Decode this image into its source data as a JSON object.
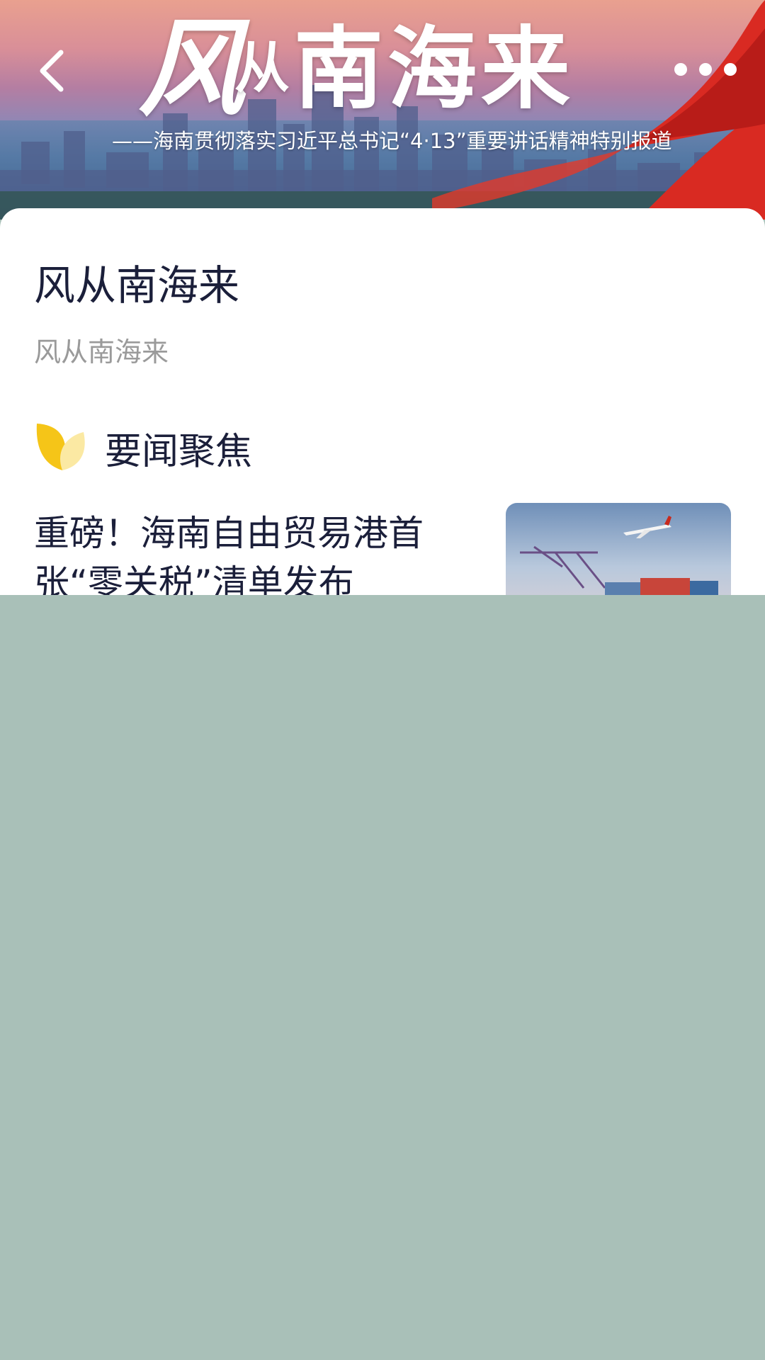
{
  "banner": {
    "title_part1": "风",
    "title_part2": "从",
    "title_part3": "南海来",
    "subtitle": "——海南贯彻落实习近平总书记“4·13”重要讲话精神特别报道"
  },
  "nav": {
    "back_icon": "chevron-left-icon",
    "more_icon": "more-dots-icon"
  },
  "page": {
    "title": "风从南海来",
    "subtitle": "风从南海来"
  },
  "section": {
    "icon": "leaf-icon",
    "title": "要闻聚焦"
  },
  "news": [
    {
      "title": "重磅！海南自由贸易港首张“零关税”清单发布"
    }
  ],
  "colors": {
    "title_text": "#1b1f3a",
    "subtitle_text": "#9a9a9a",
    "leaf_accent": "#f5c518",
    "background_below": "#a9c0b8"
  }
}
